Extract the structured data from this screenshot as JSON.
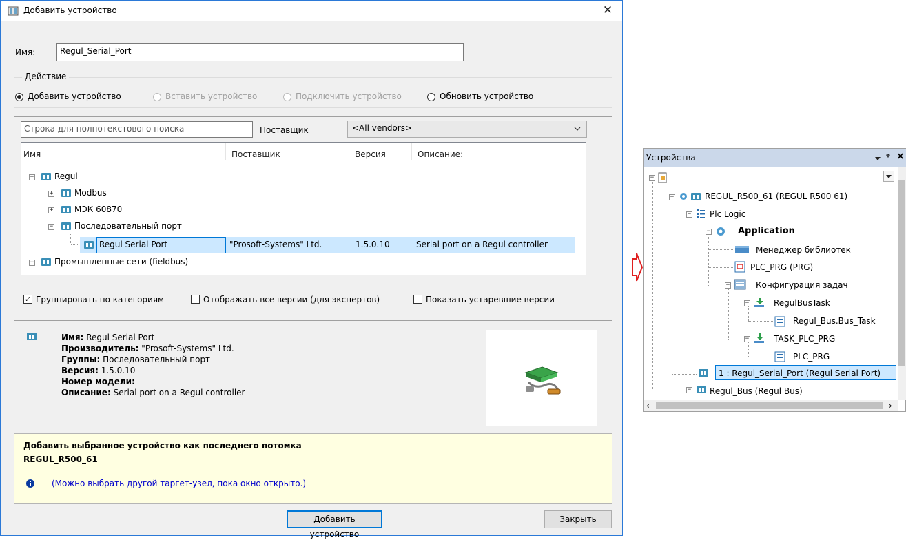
{
  "dialog": {
    "title": "Добавить устройство",
    "name_label": "Имя:",
    "name_value": "Regul_Serial_Port",
    "action_group": "Действие",
    "actions": [
      {
        "label": "Добавить устройство",
        "selected": true,
        "enabled": true
      },
      {
        "label": "Вставить устройство",
        "selected": false,
        "enabled": false
      },
      {
        "label": "Подключить устройство",
        "selected": false,
        "enabled": false
      },
      {
        "label": "Обновить устройство",
        "selected": false,
        "enabled": true
      }
    ],
    "search_placeholder": "Строка для полнотекстового поиска",
    "vendor_label": "Поставщик",
    "vendor_value": "<All vendors>",
    "columns": [
      "Имя",
      "Поставщик",
      "Версия",
      "Описание:"
    ],
    "tree": {
      "root": "Regul",
      "children": [
        "Modbus",
        "МЭК 60870",
        "Последовательный порт"
      ],
      "selected_item": {
        "name": "Regul Serial Port",
        "vendor": "\"Prosoft-Systems\" Ltd.",
        "version": "1.5.0.10",
        "description": "Serial port on a Regul controller"
      },
      "other_root": "Промышленные сети (fieldbus)"
    },
    "checkboxes": [
      {
        "label": "Группировать по категориям",
        "checked": true
      },
      {
        "label": "Отображать все версии (для экспертов)",
        "checked": false
      },
      {
        "label": "Показать устаревшие версии",
        "checked": false
      }
    ],
    "info": {
      "name_k": "Имя:",
      "name_v": "Regul Serial Port",
      "vendor_k": "Производитель:",
      "vendor_v": "\"Prosoft-Systems\" Ltd.",
      "groups_k": "Группы:",
      "groups_v": "Последовательный порт",
      "version_k": "Версия:",
      "version_v": "1.5.0.10",
      "model_k": "Номер модели:",
      "desc_k": "Описание:",
      "desc_v": "Serial port on a Regul controller"
    },
    "hint_line1": "Добавить выбранное устройство как последнего потомка",
    "hint_line2": "REGUL_R500_61",
    "hint_note": "(Можно выбрать другой таргет-узел, пока окно открыто.)",
    "add_button": "Добавить устройство",
    "close_button": "Закрыть"
  },
  "devices": {
    "title": "Устройства",
    "pin_glyph": "ᵠ",
    "close_glyph": "×",
    "items": [
      {
        "label": "REGUL_R500_61 (REGUL R500 61)"
      },
      {
        "label": "Plc Logic"
      },
      {
        "label": "Application"
      },
      {
        "label": "Менеджер библиотек"
      },
      {
        "label": "PLC_PRG (PRG)"
      },
      {
        "label": "Конфигурация задач"
      },
      {
        "label": "RegulBusTask"
      },
      {
        "label": "Regul_Bus.Bus_Task"
      },
      {
        "label": "TASK_PLC_PRG"
      },
      {
        "label": "PLC_PRG"
      },
      {
        "label": "1 : Regul_Serial_Port (Regul Serial Port)"
      },
      {
        "label": "Regul_Bus (Regul Bus)"
      }
    ]
  },
  "colors": {
    "accent": "#0078d7",
    "selection": "#cce8ff",
    "hint_bg": "#ffffe1",
    "arrow": "#e02020"
  }
}
